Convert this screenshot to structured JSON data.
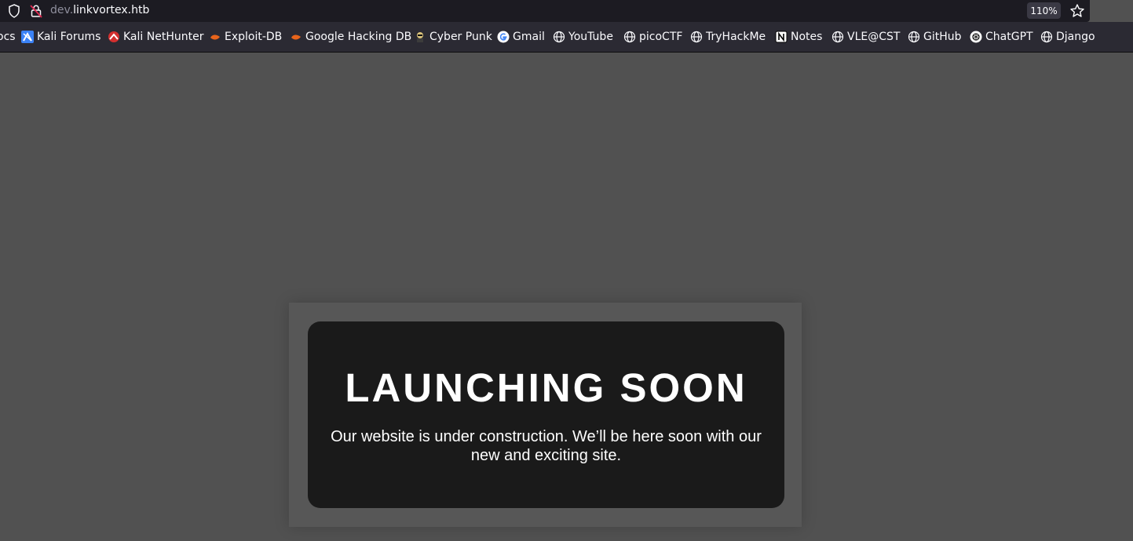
{
  "browser": {
    "url_subdomain": "dev.",
    "url_domain": "linkvortex.htb",
    "zoom": "110%"
  },
  "bookmarks": [
    {
      "label": "ocs",
      "icon": "none"
    },
    {
      "label": "Kali Forums",
      "icon": "kali-icon"
    },
    {
      "label": "Kali NetHunter",
      "icon": "nethunter-icon"
    },
    {
      "label": "Exploit-DB",
      "icon": "exploit-db-icon"
    },
    {
      "label": "Google Hacking DB",
      "icon": "exploit-db-icon"
    },
    {
      "label": "Cyber Punk",
      "icon": "cyberpunk-icon"
    },
    {
      "label": "Gmail",
      "icon": "google-icon"
    },
    {
      "label": "YouTube",
      "icon": "globe-icon"
    },
    {
      "label": "picoCTF",
      "icon": "globe-icon"
    },
    {
      "label": "TryHackMe",
      "icon": "globe-icon"
    },
    {
      "label": "Notes",
      "icon": "notion-icon"
    },
    {
      "label": "VLE@CST",
      "icon": "globe-icon"
    },
    {
      "label": "GitHub",
      "icon": "globe-icon"
    },
    {
      "label": "ChatGPT",
      "icon": "chatgpt-icon"
    },
    {
      "label": "Django",
      "icon": "globe-icon"
    }
  ],
  "page": {
    "heading": "LAUNCHING SOON",
    "message": "Our website is under construction. We’ll be here soon with our new and exciting site."
  }
}
